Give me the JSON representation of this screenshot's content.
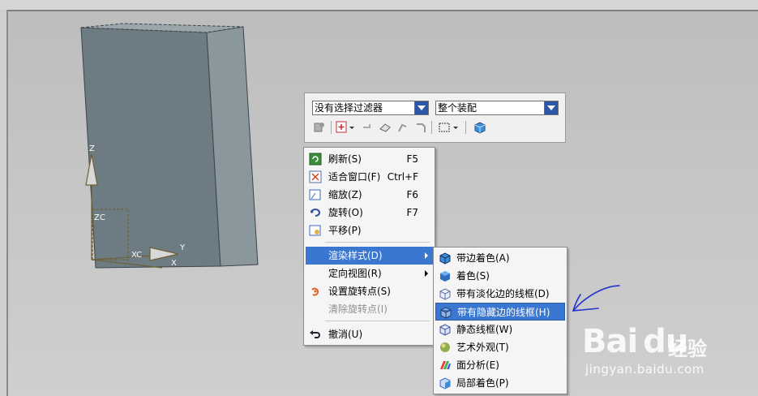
{
  "selection_bar": {
    "filter_value": "没有选择过滤器",
    "scope_value": "整个装配"
  },
  "axes": {
    "z_label": "Z",
    "zc_label": "ZC",
    "xc_label": "XC",
    "y_label": "Y",
    "x_label": "X"
  },
  "context_menu": {
    "items": [
      {
        "label": "刷新(S)",
        "shortcut": "F5",
        "icon": "refresh-icon"
      },
      {
        "label": "适合窗口(F)",
        "shortcut": "Ctrl+F",
        "icon": "fit-icon"
      },
      {
        "label": "缩放(Z)",
        "shortcut": "F6",
        "icon": "zoom-icon"
      },
      {
        "label": "旋转(O)",
        "shortcut": "F7",
        "icon": "rotate-icon"
      },
      {
        "label": "平移(P)",
        "shortcut": "",
        "icon": "pan-icon"
      },
      {
        "label": "渲染样式(D)",
        "shortcut": "",
        "icon": "",
        "submenu": true,
        "highlighted": true
      },
      {
        "label": "定向视图(R)",
        "shortcut": "",
        "icon": "",
        "submenu": true
      },
      {
        "label": "设置旋转点(S)",
        "shortcut": "",
        "icon": "rotate-point-icon"
      },
      {
        "label": "清除旋转点(I)",
        "shortcut": "",
        "icon": "",
        "disabled": true
      },
      {
        "label": "撤消(U)",
        "shortcut": "",
        "icon": "undo-icon"
      }
    ]
  },
  "render_submenu": {
    "items": [
      {
        "label": "带边着色(A)",
        "icon": "shaded-with-edges-icon"
      },
      {
        "label": "着色(S)",
        "icon": "shaded-icon"
      },
      {
        "label": "带有淡化边的线框(D)",
        "icon": "wireframe-dim-edges-icon"
      },
      {
        "label": "带有隐藏边的线框(H)",
        "icon": "wireframe-hidden-edges-icon",
        "highlighted": true
      },
      {
        "label": "静态线框(W)",
        "icon": "static-wireframe-icon"
      },
      {
        "label": "艺术外观(T)",
        "icon": "studio-icon"
      },
      {
        "label": "面分析(E)",
        "icon": "face-analysis-icon"
      },
      {
        "label": "局部着色(P)",
        "icon": "partial-shading-icon"
      }
    ]
  },
  "watermark": {
    "logo": "Bai du",
    "brand": "经验",
    "url": "jingyan.baidu.com"
  },
  "colors": {
    "highlight": "#3a77d0",
    "annotation_arrow": "#2233cc"
  }
}
